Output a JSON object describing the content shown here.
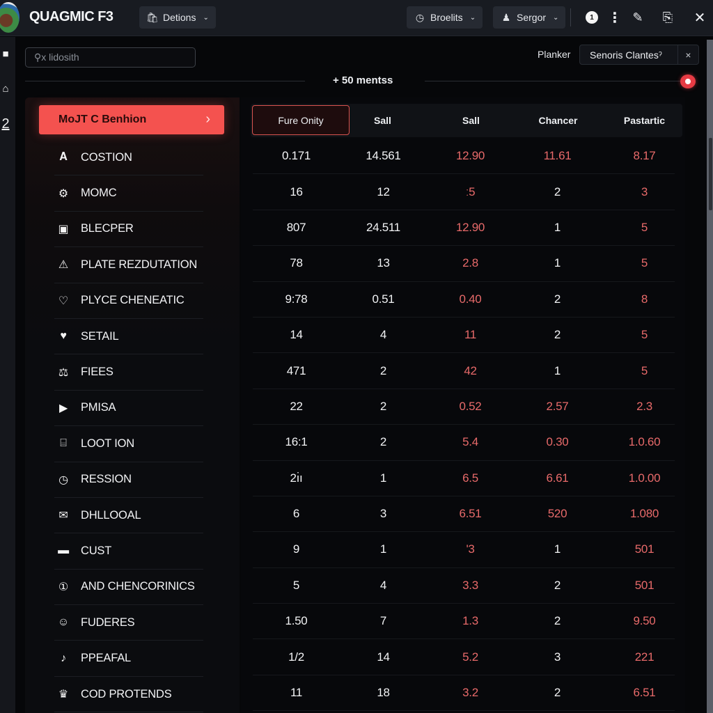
{
  "app": {
    "title": "QUAGMIC F3",
    "logo_icon": "app-logo-emblem"
  },
  "toolbar": {
    "dropdowns": [
      {
        "label": "Detions",
        "icon": "basket-icon"
      },
      {
        "label": "Broelits",
        "icon": "clock-face-icon"
      },
      {
        "label": "Sergor",
        "icon": "user-stamp-icon"
      }
    ],
    "notification_count": "1",
    "icons": [
      "notification-badge-icon",
      "more-vertical-icon",
      "pen-icon",
      "clipboard-settings-icon",
      "close-icon"
    ]
  },
  "rail": {
    "icons": [
      "user-card-icon",
      "home-icon",
      "number-two-icon"
    ]
  },
  "filters": {
    "search_placeholder": "⚲x lidosith",
    "label": "Planker",
    "chip_label": "Senoris Clantesˀ",
    "chip_close": "×",
    "more_label": "+ 50 mentss",
    "slider_value_percent": 100
  },
  "sidebar": {
    "active_item": "MoJT C Benhion",
    "items": [
      {
        "label": "COSTION",
        "icon": "a-letter-icon",
        "glyph": "𝐀"
      },
      {
        "label": "MOMC",
        "icon": "gear-icon",
        "glyph": "⚙"
      },
      {
        "label": "BLECPER",
        "icon": "keycard-icon",
        "glyph": "▣"
      },
      {
        "label": "PLATE REZDUTATION",
        "icon": "warning-icon",
        "glyph": "⚠"
      },
      {
        "label": "PLYCE CHENEATIC",
        "icon": "heart-outline-icon",
        "glyph": "♡"
      },
      {
        "label": "SETAIL",
        "icon": "heart-icon",
        "glyph": "♥"
      },
      {
        "label": "FIEES",
        "icon": "hand-coin-icon",
        "glyph": "⚖"
      },
      {
        "label": "PMISA",
        "icon": "play-icon",
        "glyph": "▶"
      },
      {
        "label": "LOOT ION",
        "icon": "stamp-icon",
        "glyph": "⌸"
      },
      {
        "label": "RESSION",
        "icon": "clock-icon",
        "glyph": "◷"
      },
      {
        "label": "DHLLOOAL",
        "icon": "mail-icon",
        "glyph": "✉"
      },
      {
        "label": "CUST",
        "icon": "folder-icon",
        "glyph": "▬"
      },
      {
        "label": "AND CHENCORINICS",
        "icon": "numbered-box-icon",
        "glyph": "①"
      },
      {
        "label": "FUDERES",
        "icon": "chat-bubble-icon",
        "glyph": "☺"
      },
      {
        "label": "PPEAFAL",
        "icon": "music-note-icon",
        "glyph": "♪"
      },
      {
        "label": "COD PROTENDS",
        "icon": "crown-icon",
        "glyph": "♛"
      }
    ]
  },
  "table": {
    "columns": [
      "Fure Onity",
      "Sall",
      "Sall",
      "Chancer",
      "Pastartic"
    ],
    "rows": [
      [
        "0.171",
        "14.561",
        "12.90",
        "11.61",
        "8.17"
      ],
      [
        "16",
        "12",
        "ː5",
        "2",
        "3"
      ],
      [
        "807",
        "24.511",
        "12.90",
        "1",
        "5"
      ],
      [
        "78",
        "13",
        "2.8",
        "1",
        "5"
      ],
      [
        "9:78",
        "0.51",
        "0.40",
        "2",
        "8"
      ],
      [
        "14",
        "4",
        "11",
        "2",
        "5"
      ],
      [
        "471",
        "2",
        "42",
        "1",
        "5"
      ],
      [
        "22",
        "2",
        "0.52",
        "2.57",
        "2.3"
      ],
      [
        "16:1",
        "2",
        "5.4",
        "0.30",
        "1.0.60"
      ],
      [
        "2ı̇ı",
        "1",
        "6.5",
        "6.61",
        "1.0.00"
      ],
      [
        "6",
        "3",
        "6.51",
        "520",
        "1.080"
      ],
      [
        "9",
        "1",
        "'3",
        "1",
        "501"
      ],
      [
        "5",
        "4",
        "3.3",
        "2",
        "501"
      ],
      [
        "1.50",
        "7",
        "1.3",
        "2",
        "9.50"
      ],
      [
        "1/2",
        "14",
        "5.2",
        "3",
        "221"
      ],
      [
        "11",
        "18",
        "3.2",
        "2",
        "6.51"
      ]
    ],
    "red_cells": [
      [
        0,
        2
      ],
      [
        0,
        3
      ],
      [
        0,
        4
      ],
      [
        1,
        2
      ],
      [
        1,
        4
      ],
      [
        2,
        2
      ],
      [
        2,
        4
      ],
      [
        3,
        2
      ],
      [
        3,
        4
      ],
      [
        4,
        2
      ],
      [
        4,
        4
      ],
      [
        5,
        2
      ],
      [
        5,
        4
      ],
      [
        6,
        2
      ],
      [
        6,
        4
      ],
      [
        7,
        2
      ],
      [
        7,
        3
      ],
      [
        7,
        4
      ],
      [
        8,
        2
      ],
      [
        8,
        3
      ],
      [
        8,
        4
      ],
      [
        9,
        2
      ],
      [
        9,
        3
      ],
      [
        9,
        4
      ],
      [
        10,
        2
      ],
      [
        10,
        3
      ],
      [
        10,
        4
      ],
      [
        11,
        2
      ],
      [
        11,
        4
      ],
      [
        12,
        2
      ],
      [
        12,
        4
      ],
      [
        13,
        2
      ],
      [
        13,
        4
      ],
      [
        14,
        2
      ],
      [
        14,
        4
      ],
      [
        15,
        2
      ],
      [
        15,
        4
      ]
    ]
  },
  "colors": {
    "accent": "#f4524f",
    "accent_text_red": "#e86a6a",
    "slider_knob": "#e63b44",
    "background": "#060709",
    "topbar": "#181b21"
  }
}
